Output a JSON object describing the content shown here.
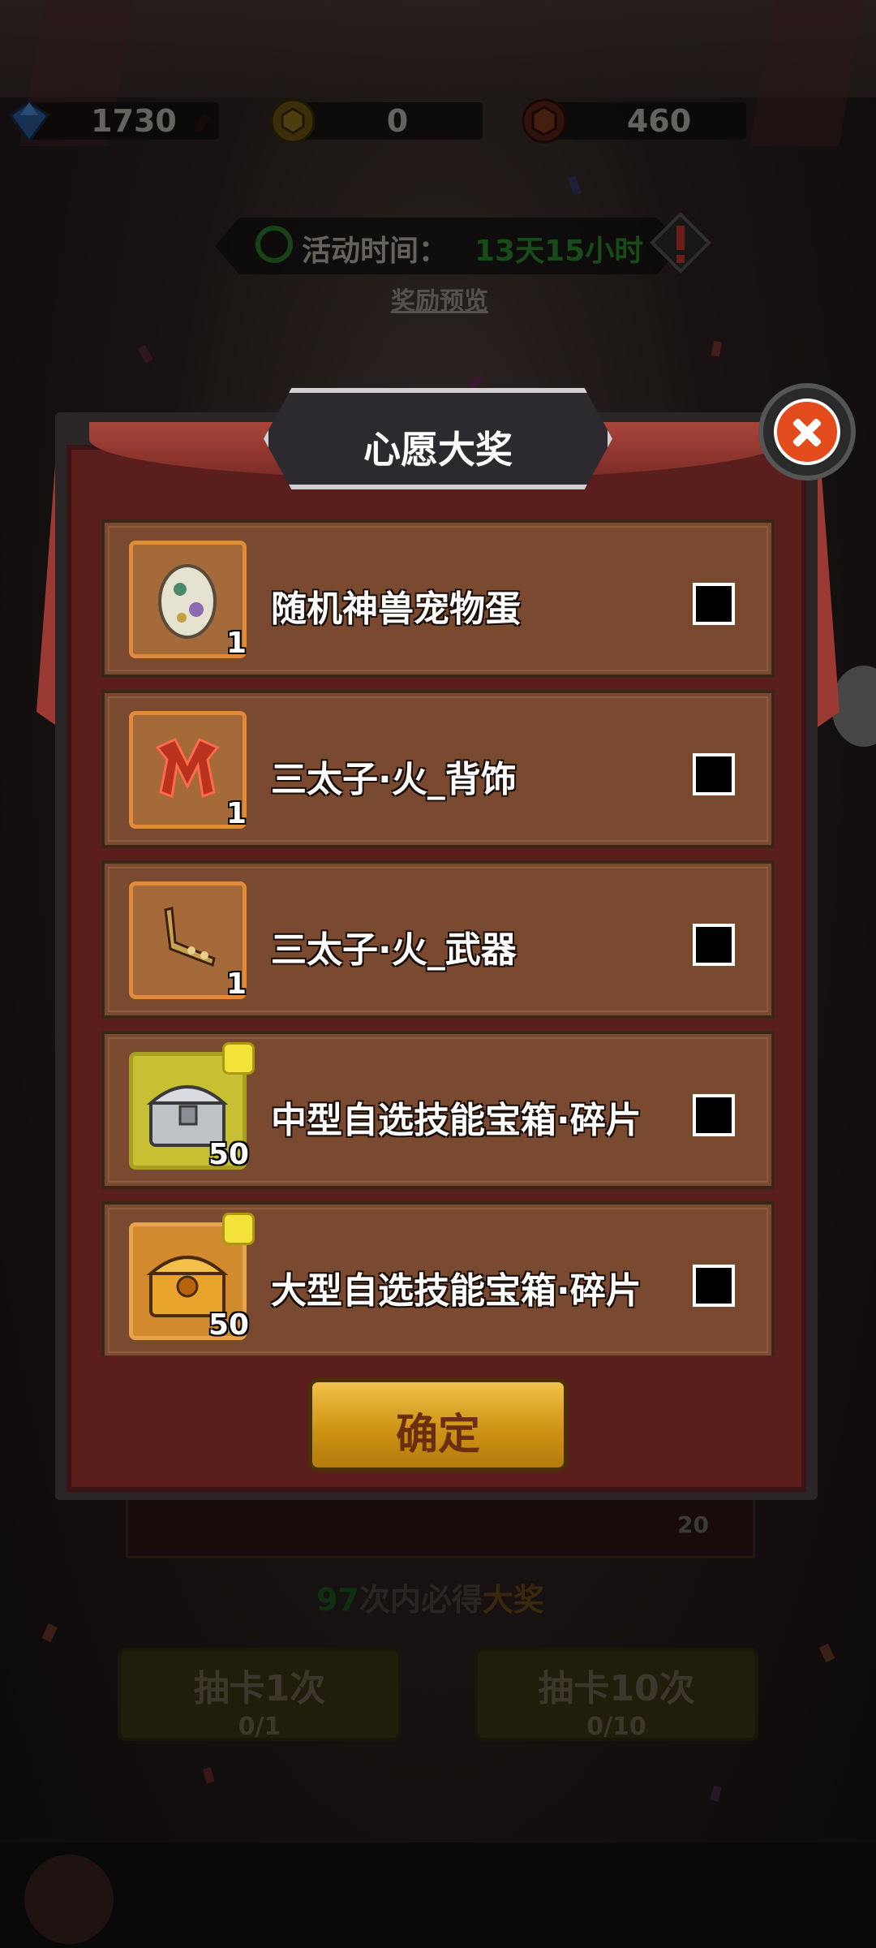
{
  "currency": {
    "gems": "1730",
    "coins": "0",
    "medals": "460"
  },
  "event": {
    "time_label": "活动时间：",
    "time_value": "13天15小时",
    "reward_preview": "奖励预览"
  },
  "modal": {
    "title": "心愿大奖",
    "items": [
      {
        "name": "随机神兽宠物蛋",
        "qty": "1",
        "icon": "egg-icon"
      },
      {
        "name": "三太子·火_背饰",
        "qty": "1",
        "icon": "back-ornament-icon"
      },
      {
        "name": "三太子·火_武器",
        "qty": "1",
        "icon": "weapon-icon"
      },
      {
        "name": "中型自选技能宝箱·碎片",
        "qty": "50",
        "icon": "silver-chest-icon"
      },
      {
        "name": "大型自选技能宝箱·碎片",
        "qty": "50",
        "icon": "gold-chest-icon"
      }
    ],
    "confirm_label": "确定"
  },
  "background": {
    "pool_count": "20",
    "guarantee_num": "97",
    "guarantee_mid": "次内必得",
    "guarantee_end": "大奖",
    "draw1": {
      "label": "抽卡1次",
      "cost": "0/1"
    },
    "draw10": {
      "label": "抽卡10次",
      "cost": "0/10"
    }
  },
  "colors": {
    "accent_gold": "#cf9414",
    "timer_green": "#2b8a2c",
    "modal_red": "#5a1e1c",
    "row_brown": "#7a4a30",
    "close_orange": "#e34b1c"
  }
}
